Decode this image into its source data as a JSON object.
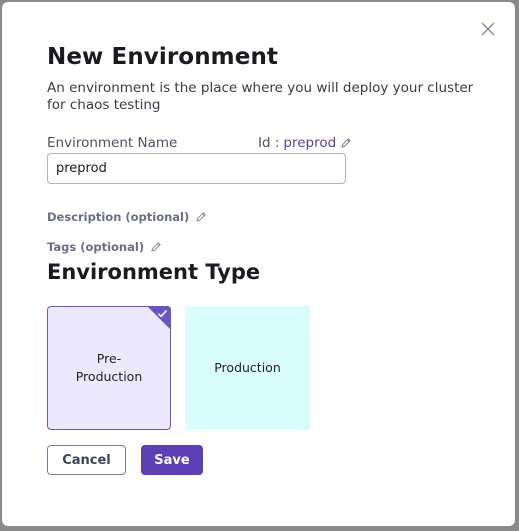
{
  "modal": {
    "title": "New Environment",
    "subtitle": "An environment is the place where you will deploy your cluster for chaos testing",
    "close_icon": "close-icon"
  },
  "environment_name": {
    "label": "Environment Name",
    "id_label": "Id :",
    "id_value": "preprod",
    "value": "preprod",
    "edit_icon": "pencil-icon"
  },
  "optional_fields": {
    "description_label": "Description (optional)",
    "tags_label": "Tags (optional)"
  },
  "environment_type": {
    "title": "Environment Type",
    "options": [
      {
        "label": "Pre-\nProduction",
        "selected": true
      },
      {
        "label": "Production",
        "selected": false
      }
    ]
  },
  "actions": {
    "cancel_label": "Cancel",
    "save_label": "Save"
  },
  "colors": {
    "accent": "#5d3fb6",
    "preprod_card_bg": "#ebe8fb",
    "prod_card_bg": "#d8fbfb"
  }
}
